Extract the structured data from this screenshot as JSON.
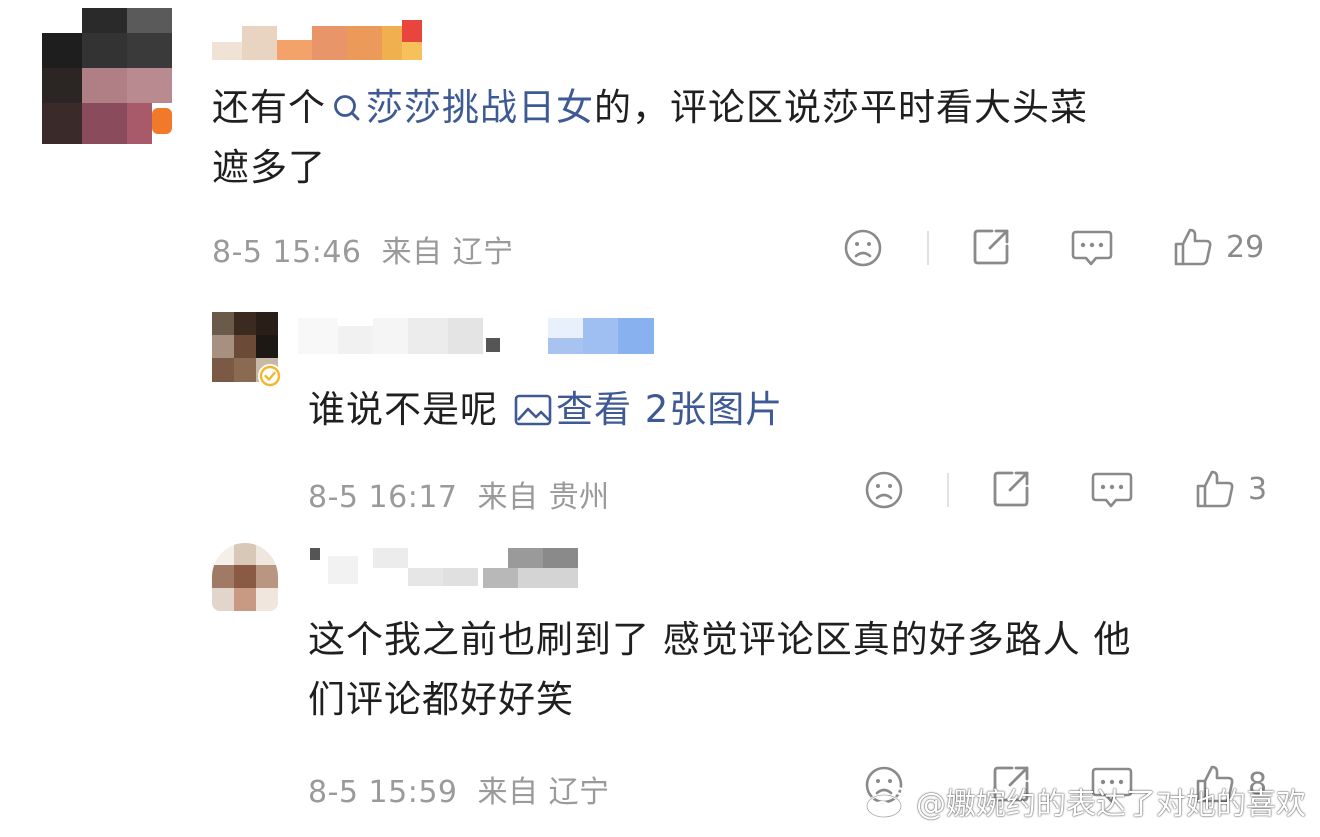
{
  "comments": [
    {
      "text_before": "还有个",
      "link_icon": "search-icon",
      "link": "莎莎挑战日女",
      "text_after": "的，评论区说莎平时看大头菜",
      "text_line2": "遮多了",
      "time": "8-5 15:46",
      "location": "来自 辽宁",
      "likes": "29"
    },
    {
      "text_before": "谁说不是呢",
      "link_icon": "image-icon",
      "link": "查看 2张图片",
      "time": "8-5 16:17",
      "location": "来自 贵州",
      "likes": "3"
    },
    {
      "text_line1": "这个我之前也刷到了 感觉评论区真的好多路人 他",
      "text_line2": "们评论都好好笑",
      "time": "8-5 15:59",
      "location": "来自 辽宁",
      "likes": "8"
    }
  ],
  "watermark": {
    "icon": "weibo-icon",
    "text": "@嫐婉约的表达了对她的喜欢"
  },
  "colors": {
    "link": "#3e5a95",
    "meta": "#9a9a9a",
    "icon": "#8a8a8a"
  }
}
